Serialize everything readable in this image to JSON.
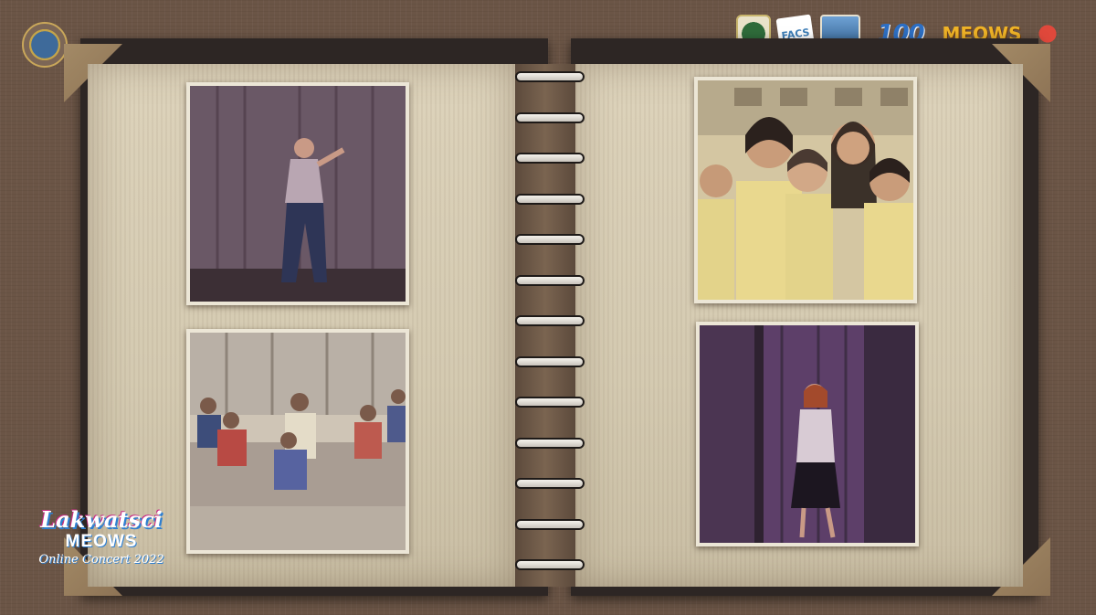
{
  "overlay": {
    "event_logo": {
      "line1": "Lakwatsci",
      "line2": "MEOWS",
      "line3": "Online Concert 2022"
    },
    "partner_logos": [
      {
        "name": "college-crest",
        "text": ""
      },
      {
        "name": "facs-logo",
        "text": "FACS"
      },
      {
        "name": "school-crest",
        "text": ""
      },
      {
        "name": "centennial-logo",
        "text": "100"
      },
      {
        "name": "meows-logo",
        "text": "MEOWS"
      },
      {
        "name": "red-seal-logo",
        "text": ""
      }
    ]
  },
  "album": {
    "ring_count": 13,
    "photos": [
      {
        "name": "photo-singer-stage",
        "scene": "performer-singing"
      },
      {
        "name": "photo-group-lounge",
        "scene": "group-portrait"
      },
      {
        "name": "photo-group-selfie",
        "scene": "group-selfie"
      },
      {
        "name": "photo-singer-spotlight",
        "scene": "performer-singing"
      }
    ]
  }
}
